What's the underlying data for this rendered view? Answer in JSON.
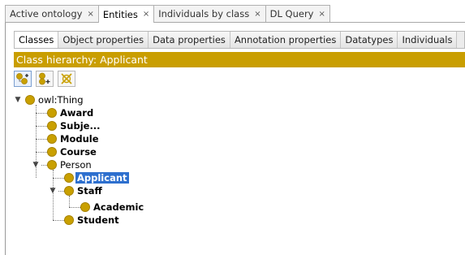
{
  "top_tabs": [
    {
      "label": "Active ontology",
      "close": "×",
      "active": false
    },
    {
      "label": "Entities",
      "close": "×",
      "active": true
    },
    {
      "label": "Individuals by class",
      "close": "×",
      "active": false
    },
    {
      "label": "DL Query",
      "close": "×",
      "active": false
    }
  ],
  "sub_tabs": [
    {
      "label": "Classes",
      "active": true
    },
    {
      "label": "Object properties",
      "active": false
    },
    {
      "label": "Data properties",
      "active": false
    },
    {
      "label": "Annotation properties",
      "active": false
    },
    {
      "label": "Datatypes",
      "active": false
    },
    {
      "label": "Individuals",
      "active": false
    }
  ],
  "header": {
    "title": "Class hierarchy: Applicant",
    "color": "#c99e00"
  },
  "toolbar": {
    "buttons": [
      {
        "icon": "add-subclass-icon"
      },
      {
        "icon": "add-sibling-class-icon"
      },
      {
        "icon": "delete-class-icon"
      }
    ]
  },
  "tree": {
    "root": {
      "label": "owl:Thing",
      "toggle": "▼"
    },
    "level1": [
      {
        "label": "Award"
      },
      {
        "label": "Subje..."
      },
      {
        "label": "Module"
      },
      {
        "label": "Course"
      },
      {
        "label": "Person",
        "toggle": "▼"
      }
    ],
    "person_children": [
      {
        "label": "Applicant",
        "selected": true
      },
      {
        "label": "Staff",
        "toggle": "▼"
      },
      {
        "label": "Student"
      }
    ],
    "staff_children": [
      {
        "label": "Academic"
      }
    ]
  },
  "colors": {
    "class_dot": "#c9a000",
    "selection": "#2d6fce"
  }
}
